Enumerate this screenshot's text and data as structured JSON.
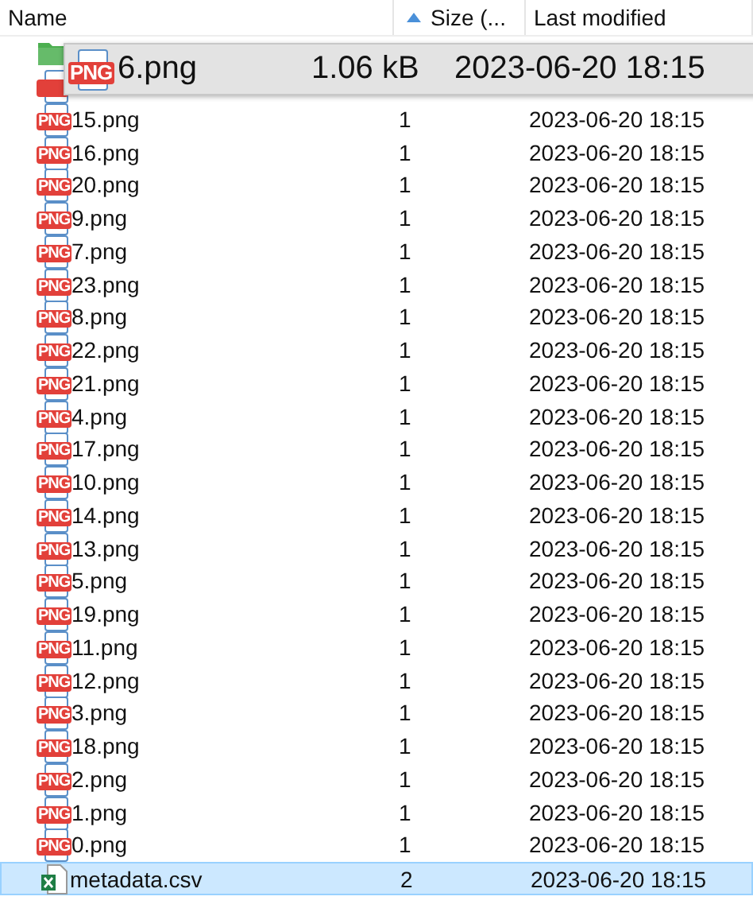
{
  "columns": [
    {
      "label": "Name",
      "sorted": false
    },
    {
      "label": "Size (...",
      "sorted": true
    },
    {
      "label": "Last modified",
      "sorted": false
    }
  ],
  "covered_rows": [
    {
      "kind": "folder"
    },
    {
      "kind": "png"
    }
  ],
  "rows": [
    {
      "kind": "png",
      "icon_label": "PNG",
      "name": "15.png",
      "size": "1",
      "modified": "2023-06-20 18:15",
      "selected": false
    },
    {
      "kind": "png",
      "icon_label": "PNG",
      "name": "16.png",
      "size": "1",
      "modified": "2023-06-20 18:15",
      "selected": false
    },
    {
      "kind": "png",
      "icon_label": "PNG",
      "name": "20.png",
      "size": "1",
      "modified": "2023-06-20 18:15",
      "selected": false
    },
    {
      "kind": "png",
      "icon_label": "PNG",
      "name": "9.png",
      "size": "1",
      "modified": "2023-06-20 18:15",
      "selected": false
    },
    {
      "kind": "png",
      "icon_label": "PNG",
      "name": "7.png",
      "size": "1",
      "modified": "2023-06-20 18:15",
      "selected": false
    },
    {
      "kind": "png",
      "icon_label": "PNG",
      "name": "23.png",
      "size": "1",
      "modified": "2023-06-20 18:15",
      "selected": false
    },
    {
      "kind": "png",
      "icon_label": "PNG",
      "name": "8.png",
      "size": "1",
      "modified": "2023-06-20 18:15",
      "selected": false
    },
    {
      "kind": "png",
      "icon_label": "PNG",
      "name": "22.png",
      "size": "1",
      "modified": "2023-06-20 18:15",
      "selected": false
    },
    {
      "kind": "png",
      "icon_label": "PNG",
      "name": "21.png",
      "size": "1",
      "modified": "2023-06-20 18:15",
      "selected": false
    },
    {
      "kind": "png",
      "icon_label": "PNG",
      "name": "4.png",
      "size": "1",
      "modified": "2023-06-20 18:15",
      "selected": false
    },
    {
      "kind": "png",
      "icon_label": "PNG",
      "name": "17.png",
      "size": "1",
      "modified": "2023-06-20 18:15",
      "selected": false
    },
    {
      "kind": "png",
      "icon_label": "PNG",
      "name": "10.png",
      "size": "1",
      "modified": "2023-06-20 18:15",
      "selected": false
    },
    {
      "kind": "png",
      "icon_label": "PNG",
      "name": "14.png",
      "size": "1",
      "modified": "2023-06-20 18:15",
      "selected": false
    },
    {
      "kind": "png",
      "icon_label": "PNG",
      "name": "13.png",
      "size": "1",
      "modified": "2023-06-20 18:15",
      "selected": false
    },
    {
      "kind": "png",
      "icon_label": "PNG",
      "name": "5.png",
      "size": "1",
      "modified": "2023-06-20 18:15",
      "selected": false
    },
    {
      "kind": "png",
      "icon_label": "PNG",
      "name": "19.png",
      "size": "1",
      "modified": "2023-06-20 18:15",
      "selected": false
    },
    {
      "kind": "png",
      "icon_label": "PNG",
      "name": "11.png",
      "size": "1",
      "modified": "2023-06-20 18:15",
      "selected": false
    },
    {
      "kind": "png",
      "icon_label": "PNG",
      "name": "12.png",
      "size": "1",
      "modified": "2023-06-20 18:15",
      "selected": false
    },
    {
      "kind": "png",
      "icon_label": "PNG",
      "name": "3.png",
      "size": "1",
      "modified": "2023-06-20 18:15",
      "selected": false
    },
    {
      "kind": "png",
      "icon_label": "PNG",
      "name": "18.png",
      "size": "1",
      "modified": "2023-06-20 18:15",
      "selected": false
    },
    {
      "kind": "png",
      "icon_label": "PNG",
      "name": "2.png",
      "size": "1",
      "modified": "2023-06-20 18:15",
      "selected": false
    },
    {
      "kind": "png",
      "icon_label": "PNG",
      "name": "1.png",
      "size": "1",
      "modified": "2023-06-20 18:15",
      "selected": false
    },
    {
      "kind": "png",
      "icon_label": "PNG",
      "name": "0.png",
      "size": "1",
      "modified": "2023-06-20 18:15",
      "selected": false
    },
    {
      "kind": "csv",
      "name": "metadata.csv",
      "size": "2",
      "modified": "2023-06-20 18:15",
      "selected": true
    }
  ],
  "drag_preview": {
    "kind": "png",
    "icon_label": "PNG",
    "name": "6.png",
    "size": "1.06 kB",
    "modified": "2023-06-20 18:15"
  }
}
